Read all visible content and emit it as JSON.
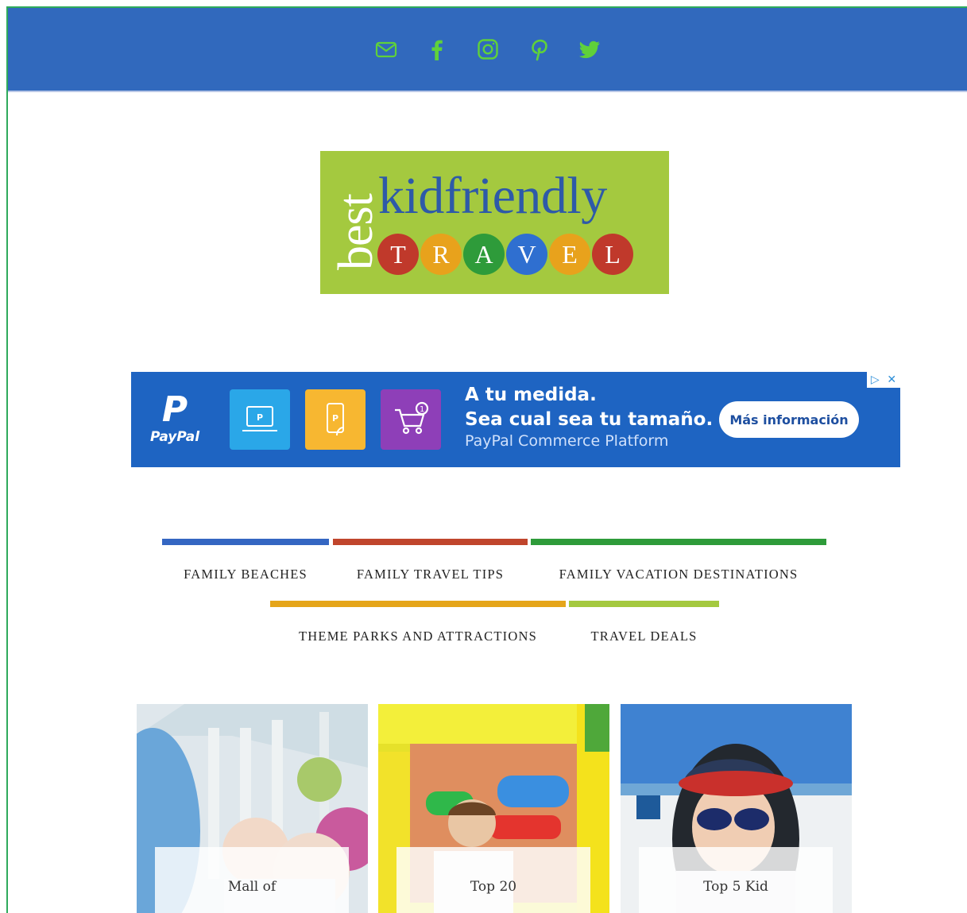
{
  "header": {
    "social": [
      {
        "name": "email",
        "icon": "mail-icon"
      },
      {
        "name": "facebook",
        "icon": "facebook-icon"
      },
      {
        "name": "instagram",
        "icon": "instagram-icon"
      },
      {
        "name": "pinterest",
        "icon": "pinterest-icon"
      },
      {
        "name": "twitter",
        "icon": "twitter-icon"
      }
    ],
    "icon_color": "#5fd13a",
    "bar_color": "#3169bd"
  },
  "logo": {
    "best": "best",
    "kidfriendly": "kidfriendly",
    "travel_letters": [
      "T",
      "R",
      "A",
      "V",
      "E",
      "L"
    ],
    "travel_colors": [
      "#c0392b",
      "#e8a21c",
      "#2e9b3a",
      "#2f6fd0",
      "#e8a21c",
      "#c0392b"
    ],
    "background": "#a4c93f"
  },
  "ad": {
    "brand": "PayPal",
    "line1": "A tu medida.",
    "line2": "Sea cual sea tu tamaño.",
    "subline": "PayPal Commerce Platform",
    "cta": "Más información",
    "adchoices_play": "▷",
    "adchoices_close": "✕"
  },
  "nav": {
    "items": [
      {
        "label": "FAMILY BEACHES",
        "color": "#3466c2"
      },
      {
        "label": "FAMILY TRAVEL TIPS",
        "color": "#c0452c"
      },
      {
        "label": "FAMILY VACATION DESTINATIONS",
        "color": "#2e9b3a"
      },
      {
        "label": "THEME PARKS AND ATTRACTIONS",
        "color": "#e5a51a"
      },
      {
        "label": "TRAVEL DEALS",
        "color": "#a4c93f"
      }
    ]
  },
  "cards": [
    {
      "title": "Mall of"
    },
    {
      "title": "Top 20"
    },
    {
      "title": "Top 5 Kid"
    }
  ]
}
